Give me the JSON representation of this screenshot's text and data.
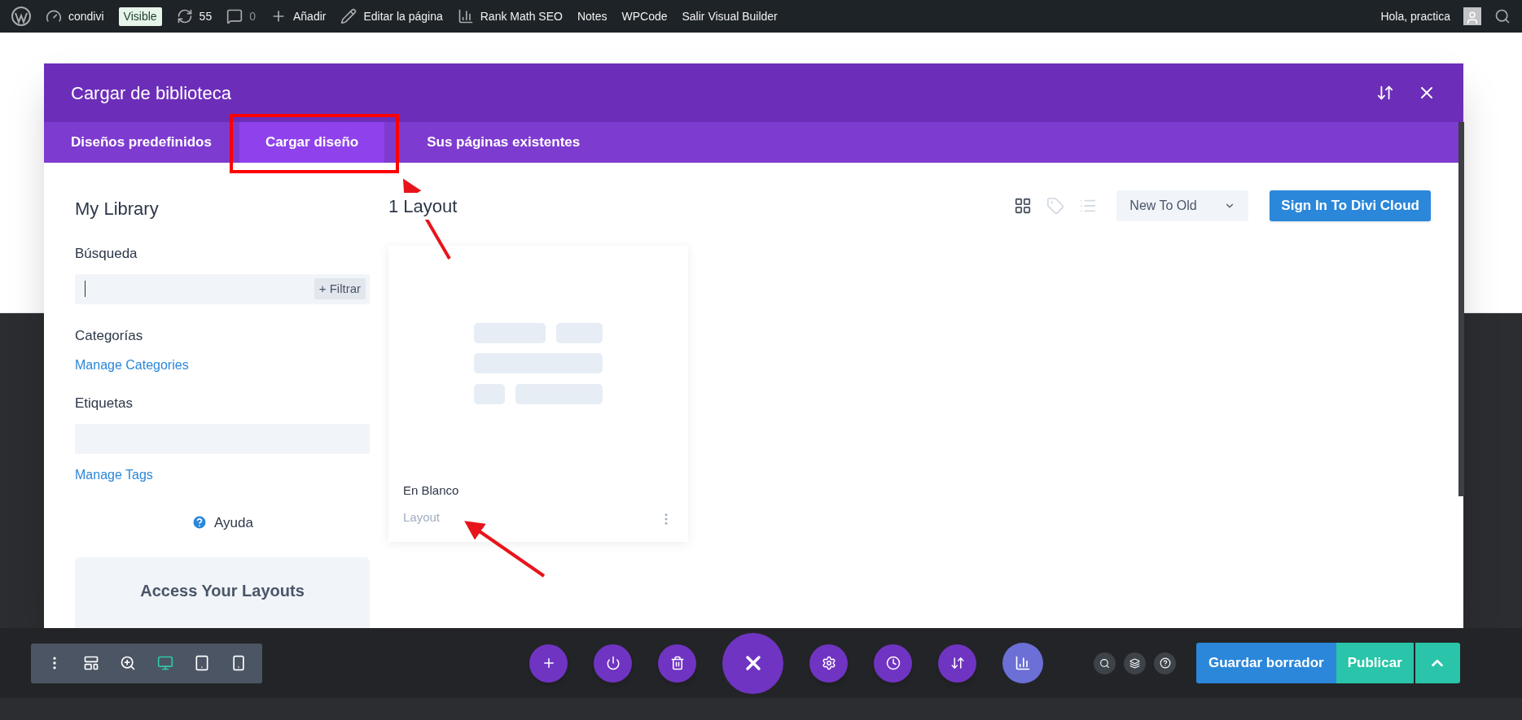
{
  "admin_bar": {
    "left": [
      {
        "kind": "wp-logo"
      },
      {
        "kind": "dashboard",
        "text": "condivi"
      },
      {
        "kind": "badge",
        "text": "Visible"
      },
      {
        "kind": "updates",
        "text": "55"
      },
      {
        "kind": "comments",
        "text": "0"
      },
      {
        "kind": "add",
        "text": "Añadir"
      },
      {
        "kind": "edit",
        "text": "Editar la página"
      },
      {
        "kind": "rankmath",
        "text": "Rank Math SEO"
      },
      {
        "kind": "plain",
        "text": "Notes"
      },
      {
        "kind": "plain",
        "text": "WPCode"
      },
      {
        "kind": "plain",
        "text": "Salir Visual Builder"
      }
    ],
    "greeting": "Hola, practica"
  },
  "modal": {
    "title": "Cargar de biblioteca",
    "tabs": [
      {
        "label": "Diseños predefinidos",
        "selected": false
      },
      {
        "label": "Cargar diseño",
        "selected": true
      },
      {
        "label": "Sus páginas existentes",
        "selected": false
      }
    ],
    "sidebar": {
      "title": "My Library",
      "search_label": "Búsqueda",
      "filter_button": "+ Filtrar",
      "categories_label": "Categorías",
      "manage_categories": "Manage Categories",
      "tags_label": "Etiquetas",
      "manage_tags": "Manage Tags",
      "help": "Ayuda",
      "promo_title": "Access Your Layouts"
    },
    "main": {
      "count": "1 Layout",
      "view_tools": [
        {
          "kind": "grid",
          "selected": true
        },
        {
          "kind": "tag",
          "selected": false
        },
        {
          "kind": "list",
          "selected": false
        }
      ],
      "sort": "New To Old",
      "cloud_button": "Sign In To Divi Cloud",
      "layouts": [
        {
          "name": "En Blanco",
          "type": "Layout"
        }
      ]
    }
  },
  "bottom_bar": {
    "devices": [
      {
        "kind": "menu",
        "selected": false
      },
      {
        "kind": "layout",
        "selected": false
      },
      {
        "kind": "zoom",
        "selected": false
      },
      {
        "kind": "desktop",
        "selected": true
      },
      {
        "kind": "tablet",
        "selected": false
      },
      {
        "kind": "phone",
        "selected": false
      }
    ],
    "save_button": "Guardar borrador",
    "publish_button": "Publicar"
  }
}
